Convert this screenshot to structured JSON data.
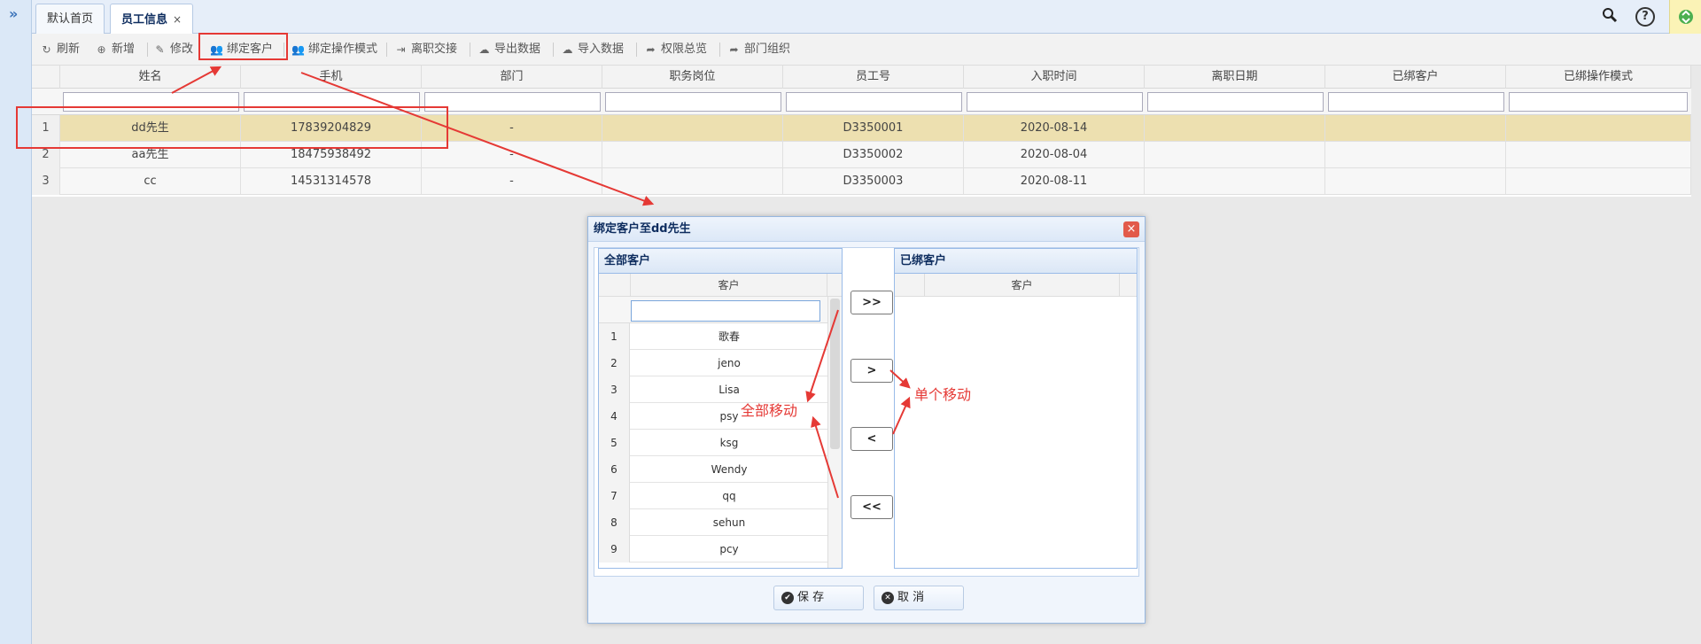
{
  "sidebar": {
    "expand_icon": "»"
  },
  "tabs": [
    {
      "label": "默认首页"
    },
    {
      "label": "员工信息",
      "close": "×"
    }
  ],
  "toolbar": {
    "buttons": [
      {
        "label": "刷新",
        "icon": "refresh-icon",
        "glyph": "↻"
      },
      {
        "label": "新增",
        "icon": "add-icon",
        "glyph": "⊕"
      },
      {
        "label": "修改",
        "icon": "edit-icon",
        "glyph": "✎"
      },
      {
        "label": "绑定客户",
        "icon": "users-icon",
        "glyph": "👥"
      },
      {
        "label": "绑定操作模式",
        "icon": "users-icon",
        "glyph": "👥"
      },
      {
        "label": "离职交接",
        "icon": "exit-icon",
        "glyph": "⇥"
      },
      {
        "label": "导出数据",
        "icon": "cloud-download-icon",
        "glyph": "☁"
      },
      {
        "label": "导入数据",
        "icon": "cloud-upload-icon",
        "glyph": "☁"
      },
      {
        "label": "权限总览",
        "icon": "share-icon",
        "glyph": "➦"
      },
      {
        "label": "部门组织",
        "icon": "share-icon",
        "glyph": "➦"
      }
    ]
  },
  "grid": {
    "columns": [
      "姓名",
      "手机",
      "部门",
      "职务岗位",
      "员工号",
      "入职时间",
      "离职日期",
      "已绑客户",
      "已绑操作模式"
    ],
    "rows": [
      {
        "num": "1",
        "cells": [
          "dd先生",
          "17839204829",
          "-",
          "",
          "D3350001",
          "2020-08-14",
          "",
          "",
          ""
        ]
      },
      {
        "num": "2",
        "cells": [
          "aa先生",
          "18475938492",
          "-",
          "",
          "D3350002",
          "2020-08-04",
          "",
          "",
          ""
        ]
      },
      {
        "num": "3",
        "cells": [
          "cc",
          "14531314578",
          "-",
          "",
          "D3350003",
          "2020-08-11",
          "",
          "",
          ""
        ]
      }
    ]
  },
  "dialog": {
    "title": "绑定客户至dd先生",
    "close": "×",
    "left_panel": {
      "title": "全部客户",
      "column": "客户",
      "rows": [
        {
          "num": "1",
          "value": "歌春"
        },
        {
          "num": "2",
          "value": "jeno"
        },
        {
          "num": "3",
          "value": "Lisa"
        },
        {
          "num": "4",
          "value": "psy"
        },
        {
          "num": "5",
          "value": "ksg"
        },
        {
          "num": "6",
          "value": "Wendy"
        },
        {
          "num": "7",
          "value": "qq"
        },
        {
          "num": "8",
          "value": "sehun"
        },
        {
          "num": "9",
          "value": "pcy"
        }
      ]
    },
    "right_panel": {
      "title": "已绑客户",
      "column": "客户"
    },
    "move_buttons": {
      "all_right": ">>",
      "one_right": ">",
      "one_left": "<",
      "all_left": "<<"
    },
    "save_label": "保 存",
    "cancel_label": "取 消"
  },
  "annotations": {
    "all_move": "全部移动",
    "single_move": "单个移动",
    "color": "#e53935"
  }
}
